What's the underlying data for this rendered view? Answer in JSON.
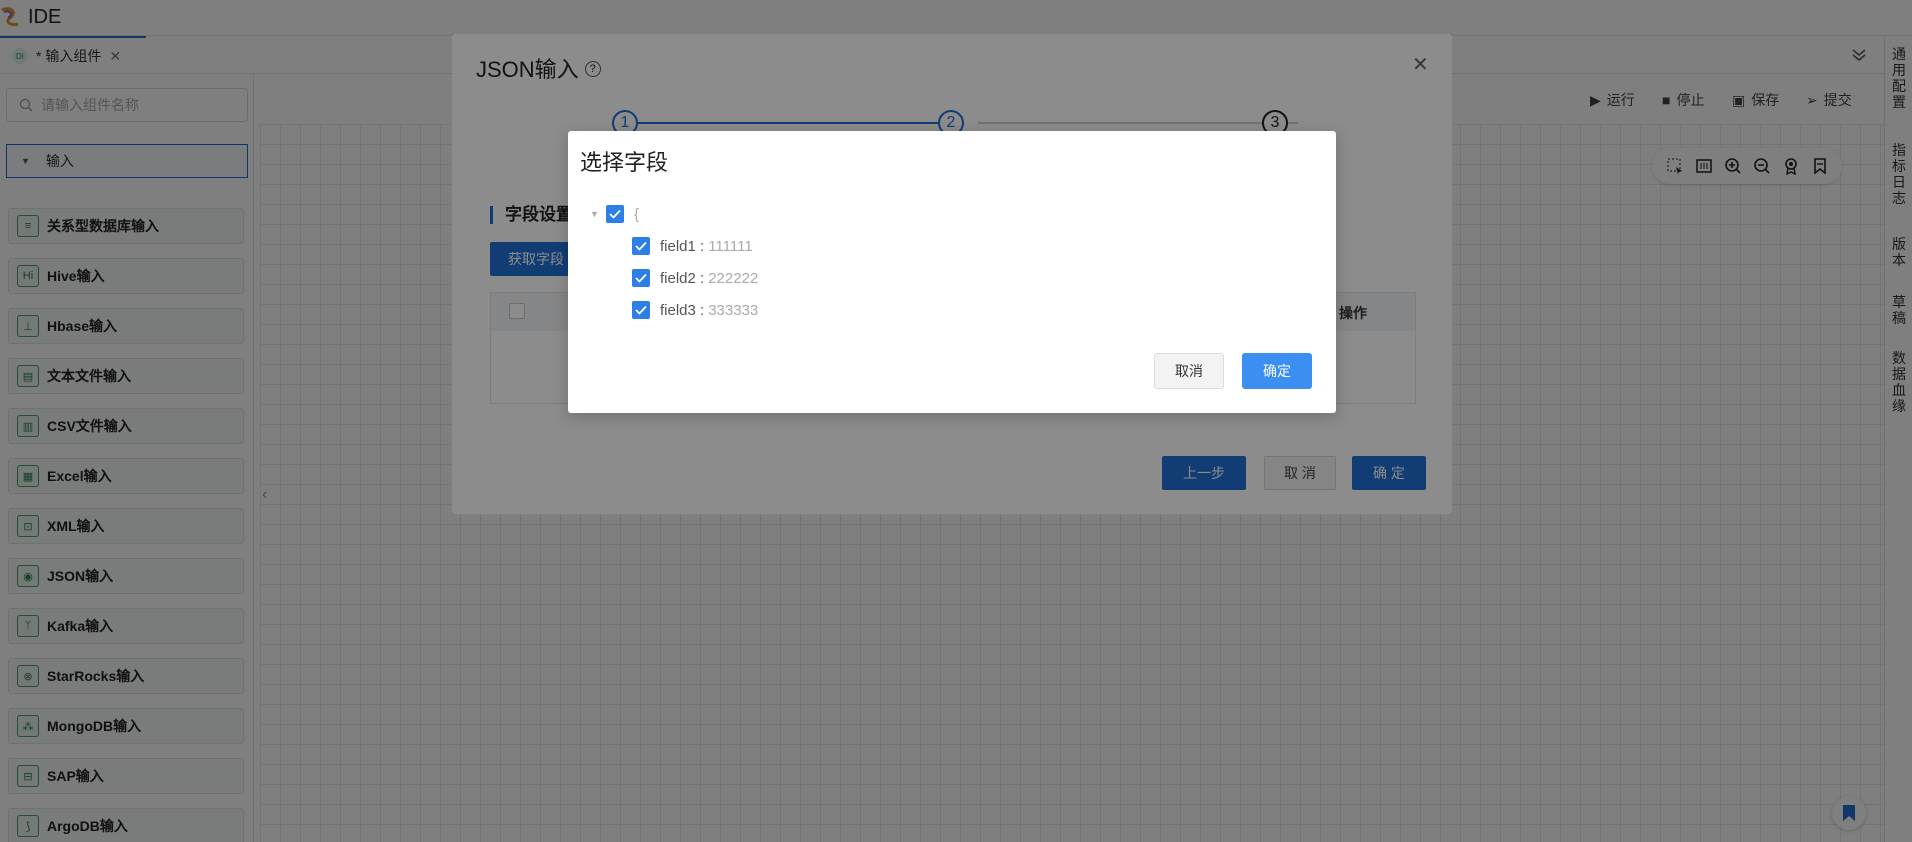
{
  "app": {
    "title": "IDE"
  },
  "tab": {
    "badge": "DI",
    "label": "* 输入组件"
  },
  "search": {
    "placeholder": "请输入组件名称"
  },
  "group": {
    "label": "输入"
  },
  "components": [
    {
      "label": "关系型数据库输入",
      "icon": "database-icon"
    },
    {
      "label": "Hive输入",
      "icon": "hive-icon",
      "glyph": "Hi"
    },
    {
      "label": "Hbase输入",
      "icon": "hbase-icon"
    },
    {
      "label": "文本文件输入",
      "icon": "text-file-icon"
    },
    {
      "label": "CSV文件输入",
      "icon": "csv-file-icon"
    },
    {
      "label": "Excel输入",
      "icon": "excel-icon"
    },
    {
      "label": "XML输入",
      "icon": "xml-icon"
    },
    {
      "label": "JSON输入",
      "icon": "json-icon"
    },
    {
      "label": "Kafka输入",
      "icon": "kafka-icon"
    },
    {
      "label": "StarRocks输入",
      "icon": "starrocks-icon"
    },
    {
      "label": "MongoDB输入",
      "icon": "mongodb-icon"
    },
    {
      "label": "SAP输入",
      "icon": "sap-icon"
    },
    {
      "label": "ArgoDB输入",
      "icon": "argodb-icon"
    }
  ],
  "toolbar": {
    "run": "运行",
    "stop": "停止",
    "save": "保存",
    "submit": "提交"
  },
  "right_panel": [
    {
      "label": "通用配置"
    },
    {
      "label": "指标日志"
    },
    {
      "label": "版本"
    },
    {
      "label": "草稿"
    },
    {
      "label": "数据血缘"
    }
  ],
  "json_modal": {
    "title": "JSON输入",
    "steps": [
      "1",
      "2",
      "3"
    ],
    "current_step": 3,
    "section_title": "字段设置",
    "fetch_button": "获取字段",
    "table_header_op": "操作",
    "prev_button": "上一步",
    "cancel_button": "取 消",
    "ok_button": "确 定"
  },
  "dialog": {
    "title": "选择字段",
    "root_label": "{",
    "fields": [
      {
        "name": "field1",
        "value": "111111"
      },
      {
        "name": "field2",
        "value": "222222"
      },
      {
        "name": "field3",
        "value": "333333"
      }
    ],
    "cancel": "取消",
    "confirm": "确定"
  },
  "colors": {
    "primary": "#1f6fd4",
    "checkbox": "#2d7ee6",
    "confirm": "#3b8ff0"
  }
}
